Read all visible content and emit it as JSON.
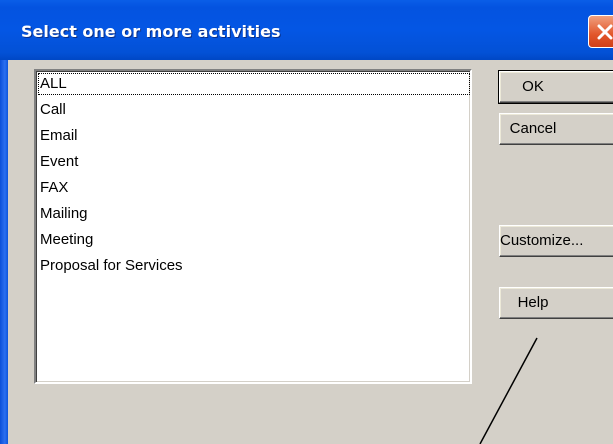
{
  "dialog": {
    "title": "Select one or more activities"
  },
  "list": {
    "items": [
      {
        "label": "ALL",
        "focused": true
      },
      {
        "label": "Call"
      },
      {
        "label": "Email"
      },
      {
        "label": "Event"
      },
      {
        "label": "FAX"
      },
      {
        "label": "Mailing"
      },
      {
        "label": "Meeting"
      },
      {
        "label": "Proposal for Services"
      }
    ]
  },
  "buttons": {
    "ok": "OK",
    "cancel": "Cancel",
    "customize": "Customize...",
    "help": "Help"
  },
  "colors": {
    "title_bar": "#0456e4",
    "dialog_face": "#d4d0c8",
    "close_button": "#e2562a"
  },
  "icons": {
    "close": "close-x-icon"
  }
}
